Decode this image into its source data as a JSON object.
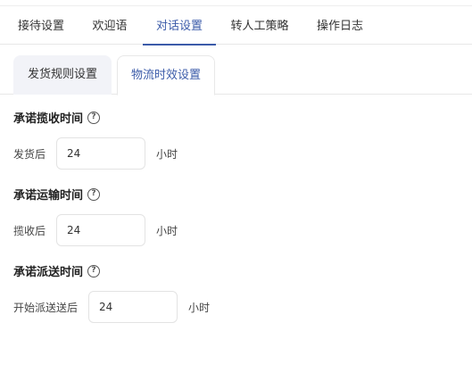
{
  "top_tabs": [
    {
      "label": "接待设置"
    },
    {
      "label": "欢迎语"
    },
    {
      "label": "对话设置"
    },
    {
      "label": "转人工策略"
    },
    {
      "label": "操作日志"
    }
  ],
  "active_top_tab": "对话设置",
  "sub_tabs": [
    {
      "label": "发货规则设置"
    },
    {
      "label": "物流时效设置"
    }
  ],
  "active_sub_tab": "物流时效设置",
  "sections": [
    {
      "title": "承诺揽收时间",
      "help_icon": "question-circle-icon",
      "label": "发货后",
      "value": "24",
      "unit": "小时"
    },
    {
      "title": "承诺运输时间",
      "help_icon": "question-circle-icon",
      "label": "揽收后",
      "value": "24",
      "unit": "小时"
    },
    {
      "title": "承诺派送时间",
      "help_icon": "question-circle-icon",
      "label": "开始派送送后",
      "value": "24",
      "unit": "小时"
    }
  ],
  "colors": {
    "accent": "#3b5ba9",
    "inactive_tab_bg": "#f2f3f8",
    "border": "#e3e3e3"
  }
}
